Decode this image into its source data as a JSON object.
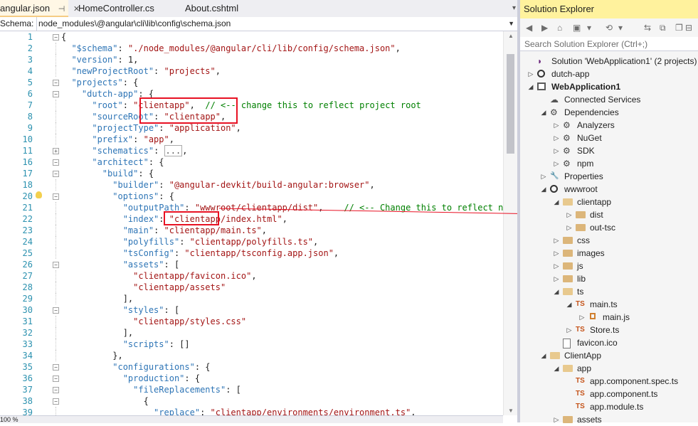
{
  "tabs": [
    {
      "label": "angular.json",
      "pin": "⊣",
      "close": "✕",
      "active": true
    },
    {
      "label": "HomeController.cs",
      "active": false
    },
    {
      "label": "About.cshtml",
      "active": false
    }
  ],
  "tab_overflow": "▾",
  "schema": {
    "label": "Schema:",
    "value": "node_modules\\@angular\\cli\\lib\\config\\schema.json"
  },
  "zoom": "100 %",
  "code_lines": [
    {
      "n": "1",
      "fold": "-",
      "segs": [
        [
          "p",
          "{"
        ]
      ]
    },
    {
      "n": "2",
      "segs": [
        [
          "p",
          "  "
        ],
        [
          "k",
          "\"$schema\""
        ],
        [
          "p",
          ": "
        ],
        [
          "s",
          "\"./node_modules/@angular/cli/lib/config/schema.json\""
        ],
        [
          "p",
          ","
        ]
      ]
    },
    {
      "n": "3",
      "segs": [
        [
          "p",
          "  "
        ],
        [
          "k",
          "\"version\""
        ],
        [
          "p",
          ": 1,"
        ]
      ]
    },
    {
      "n": "4",
      "segs": [
        [
          "p",
          "  "
        ],
        [
          "k",
          "\"newProjectRoot\""
        ],
        [
          "p",
          ": "
        ],
        [
          "s",
          "\"projects\""
        ],
        [
          "p",
          ","
        ]
      ]
    },
    {
      "n": "5",
      "fold": "-",
      "segs": [
        [
          "p",
          "  "
        ],
        [
          "k",
          "\"projects\""
        ],
        [
          "p",
          ": {"
        ]
      ]
    },
    {
      "n": "6",
      "fold": "-",
      "segs": [
        [
          "p",
          "    "
        ],
        [
          "k",
          "\"dutch-app\""
        ],
        [
          "p",
          ": {"
        ]
      ]
    },
    {
      "n": "7",
      "segs": [
        [
          "p",
          "      "
        ],
        [
          "k",
          "\"root\""
        ],
        [
          "p",
          ": "
        ],
        [
          "s",
          "\"clientapp\""
        ],
        [
          "p",
          ",  "
        ],
        [
          "c",
          "// <-- change this to reflect project root"
        ]
      ]
    },
    {
      "n": "8",
      "segs": [
        [
          "p",
          "      "
        ],
        [
          "k",
          "\"sourceRoot\""
        ],
        [
          "p",
          ": "
        ],
        [
          "s",
          "\"clientapp\""
        ],
        [
          "p",
          ","
        ]
      ]
    },
    {
      "n": "9",
      "segs": [
        [
          "p",
          "      "
        ],
        [
          "k",
          "\"projectType\""
        ],
        [
          "p",
          ": "
        ],
        [
          "s",
          "\"application\""
        ],
        [
          "p",
          ","
        ]
      ]
    },
    {
      "n": "10",
      "segs": [
        [
          "p",
          "      "
        ],
        [
          "k",
          "\"prefix\""
        ],
        [
          "p",
          ": "
        ],
        [
          "s",
          "\"app\""
        ],
        [
          "p",
          ","
        ]
      ]
    },
    {
      "n": "11",
      "fold": "+",
      "segs": [
        [
          "p",
          "      "
        ],
        [
          "k",
          "\"schematics\""
        ],
        [
          "p",
          ": "
        ],
        [
          "x",
          "..."
        ],
        [
          "p",
          ","
        ]
      ]
    },
    {
      "n": "16",
      "fold": "-",
      "segs": [
        [
          "p",
          "      "
        ],
        [
          "k",
          "\"architect\""
        ],
        [
          "p",
          ": {"
        ]
      ]
    },
    {
      "n": "17",
      "fold": "-",
      "segs": [
        [
          "p",
          "        "
        ],
        [
          "k",
          "\"build\""
        ],
        [
          "p",
          ": {"
        ]
      ]
    },
    {
      "n": "18",
      "segs": [
        [
          "p",
          "          "
        ],
        [
          "k",
          "\"builder\""
        ],
        [
          "p",
          ": "
        ],
        [
          "s",
          "\"@angular-devkit/build-angular:browser\""
        ],
        [
          "p",
          ","
        ]
      ]
    },
    {
      "n": "20",
      "fold": "-",
      "bulb": true,
      "segs": [
        [
          "p",
          "          "
        ],
        [
          "k",
          "\"options\""
        ],
        [
          "p",
          ": {"
        ]
      ]
    },
    {
      "n": "21",
      "segs": [
        [
          "p",
          "            "
        ],
        [
          "k",
          "\"outputPath\""
        ],
        [
          "p",
          ": "
        ],
        [
          "s",
          "\"wwwroot/clientapp/dist\""
        ],
        [
          "p",
          ",    "
        ],
        [
          "c",
          "// <-- Change this to reflect new w"
        ]
      ]
    },
    {
      "n": "22",
      "segs": [
        [
          "p",
          "            "
        ],
        [
          "k",
          "\"index\""
        ],
        [
          "p",
          ": "
        ],
        [
          "s",
          "\"clientapp/index.html\""
        ],
        [
          "p",
          ","
        ]
      ]
    },
    {
      "n": "23",
      "segs": [
        [
          "p",
          "            "
        ],
        [
          "k",
          "\"main\""
        ],
        [
          "p",
          ": "
        ],
        [
          "s",
          "\"clientapp/main.ts\""
        ],
        [
          "p",
          ","
        ]
      ]
    },
    {
      "n": "24",
      "segs": [
        [
          "p",
          "            "
        ],
        [
          "k",
          "\"polyfills\""
        ],
        [
          "p",
          ": "
        ],
        [
          "s",
          "\"clientapp/polyfills.ts\""
        ],
        [
          "p",
          ","
        ]
      ]
    },
    {
      "n": "25",
      "segs": [
        [
          "p",
          "            "
        ],
        [
          "k",
          "\"tsConfig\""
        ],
        [
          "p",
          ": "
        ],
        [
          "s",
          "\"clientapp/tsconfig.app.json\""
        ],
        [
          "p",
          ","
        ]
      ]
    },
    {
      "n": "26",
      "fold": "-",
      "segs": [
        [
          "p",
          "            "
        ],
        [
          "k",
          "\"assets\""
        ],
        [
          "p",
          ": ["
        ]
      ]
    },
    {
      "n": "27",
      "segs": [
        [
          "p",
          "              "
        ],
        [
          "s",
          "\"clientapp/favicon.ico\""
        ],
        [
          "p",
          ","
        ]
      ]
    },
    {
      "n": "28",
      "segs": [
        [
          "p",
          "              "
        ],
        [
          "s",
          "\"clientapp/assets\""
        ]
      ]
    },
    {
      "n": "29",
      "segs": [
        [
          "p",
          "            ],"
        ]
      ]
    },
    {
      "n": "30",
      "fold": "-",
      "segs": [
        [
          "p",
          "            "
        ],
        [
          "k",
          "\"styles\""
        ],
        [
          "p",
          ": ["
        ]
      ]
    },
    {
      "n": "31",
      "segs": [
        [
          "p",
          "              "
        ],
        [
          "s",
          "\"clientapp/styles.css\""
        ]
      ]
    },
    {
      "n": "32",
      "segs": [
        [
          "p",
          "            ],"
        ]
      ]
    },
    {
      "n": "33",
      "segs": [
        [
          "p",
          "            "
        ],
        [
          "k",
          "\"scripts\""
        ],
        [
          "p",
          ": []"
        ]
      ]
    },
    {
      "n": "34",
      "segs": [
        [
          "p",
          "          },"
        ]
      ]
    },
    {
      "n": "35",
      "fold": "-",
      "segs": [
        [
          "p",
          "          "
        ],
        [
          "k",
          "\"configurations\""
        ],
        [
          "p",
          ": {"
        ]
      ]
    },
    {
      "n": "36",
      "fold": "-",
      "segs": [
        [
          "p",
          "            "
        ],
        [
          "k",
          "\"production\""
        ],
        [
          "p",
          ": {"
        ]
      ]
    },
    {
      "n": "37",
      "fold": "-",
      "segs": [
        [
          "p",
          "              "
        ],
        [
          "k",
          "\"fileReplacements\""
        ],
        [
          "p",
          ": ["
        ]
      ]
    },
    {
      "n": "38",
      "fold": "-",
      "segs": [
        [
          "p",
          "                {"
        ]
      ]
    },
    {
      "n": "39",
      "segs": [
        [
          "p",
          "                  "
        ],
        [
          "k",
          "\"replace\""
        ],
        [
          "p",
          ": "
        ],
        [
          "s",
          "\"clientapp/environments/environment.ts\""
        ],
        [
          "p",
          ","
        ]
      ]
    }
  ],
  "solution_explorer": {
    "title": "Solution Explorer",
    "search_placeholder": "Search Solution Explorer (Ctrl+;)",
    "toolbar": [
      "◀",
      "▶",
      "⌂",
      "▣",
      "▾",
      "⟲",
      "▾",
      "⇆",
      "⧉",
      "❐",
      "⊟"
    ],
    "nodes": [
      {
        "label": "Solution 'WebApplication1' (2 projects)",
        "depth": 0,
        "exp": "",
        "icon": "sol"
      },
      {
        "label": "dutch-app",
        "depth": 0,
        "exp": "▷",
        "icon": "globe"
      },
      {
        "label": "WebApplication1",
        "depth": 0,
        "exp": "◢",
        "icon": "proj",
        "bold": true
      },
      {
        "label": "Connected Services",
        "depth": 1,
        "exp": "",
        "icon": "svc"
      },
      {
        "label": "Dependencies",
        "depth": 1,
        "exp": "◢",
        "icon": "dep"
      },
      {
        "label": "Analyzers",
        "depth": 2,
        "exp": "▷",
        "icon": "dep"
      },
      {
        "label": "NuGet",
        "depth": 2,
        "exp": "▷",
        "icon": "dep"
      },
      {
        "label": "SDK",
        "depth": 2,
        "exp": "▷",
        "icon": "dep"
      },
      {
        "label": "npm",
        "depth": 2,
        "exp": "▷",
        "icon": "dep"
      },
      {
        "label": "Properties",
        "depth": 1,
        "exp": "▷",
        "icon": "wrench"
      },
      {
        "label": "wwwroot",
        "depth": 1,
        "exp": "◢",
        "icon": "globe"
      },
      {
        "label": "clientapp",
        "depth": 2,
        "exp": "◢",
        "icon": "folder-open"
      },
      {
        "label": "dist",
        "depth": 3,
        "exp": "▷",
        "icon": "folder"
      },
      {
        "label": "out-tsc",
        "depth": 3,
        "exp": "▷",
        "icon": "folder"
      },
      {
        "label": "css",
        "depth": 2,
        "exp": "▷",
        "icon": "folder"
      },
      {
        "label": "images",
        "depth": 2,
        "exp": "▷",
        "icon": "folder"
      },
      {
        "label": "js",
        "depth": 2,
        "exp": "▷",
        "icon": "folder"
      },
      {
        "label": "lib",
        "depth": 2,
        "exp": "▷",
        "icon": "folder"
      },
      {
        "label": "ts",
        "depth": 2,
        "exp": "◢",
        "icon": "folder-open"
      },
      {
        "label": "main.ts",
        "depth": 3,
        "exp": "◢",
        "icon": "ts"
      },
      {
        "label": "main.js",
        "depth": 4,
        "exp": "▷",
        "icon": "js"
      },
      {
        "label": "Store.ts",
        "depth": 3,
        "exp": "▷",
        "icon": "ts"
      },
      {
        "label": "favicon.ico",
        "depth": 2,
        "exp": "",
        "icon": "file"
      },
      {
        "label": "ClientApp",
        "depth": 1,
        "exp": "◢",
        "icon": "folder-open"
      },
      {
        "label": "app",
        "depth": 2,
        "exp": "◢",
        "icon": "folder-open"
      },
      {
        "label": "app.component.spec.ts",
        "depth": 3,
        "exp": "",
        "icon": "ts"
      },
      {
        "label": "app.component.ts",
        "depth": 3,
        "exp": "",
        "icon": "ts"
      },
      {
        "label": "app.module.ts",
        "depth": 3,
        "exp": "",
        "icon": "ts"
      },
      {
        "label": "assets",
        "depth": 2,
        "exp": "▷",
        "icon": "folder"
      }
    ]
  },
  "colors": {
    "highlight": "#e81123",
    "keyword": "#2e75b6",
    "string": "#a31515",
    "comment": "#008000"
  }
}
